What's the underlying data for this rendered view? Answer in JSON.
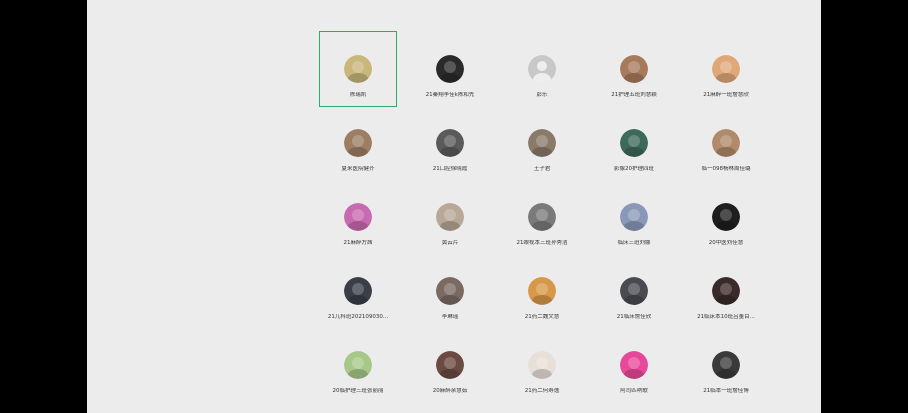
{
  "theme": {
    "background": "#000000",
    "panel": "#ececec",
    "selection_border": "#2aae67",
    "text": "#333333"
  },
  "contacts": [
    {
      "name": "陈瑞凯",
      "avatar_icon": "avatar-photo-icon",
      "color": "#c9b67a",
      "selected": true
    },
    {
      "name": "21秦翔李佳k陈和先",
      "avatar_icon": "avatar-photo-icon",
      "color": "#2a2a2a",
      "selected": false
    },
    {
      "name": "彭乐",
      "avatar_icon": "default-avatar-icon",
      "color": "#c8c8c8",
      "selected": false
    },
    {
      "name": "21护理五班刘慧颖",
      "avatar_icon": "avatar-photo-icon",
      "color": "#a87a5c",
      "selected": false
    },
    {
      "name": "21麻醉一班詹慧欣",
      "avatar_icon": "avatar-photo-icon",
      "color": "#e0a878",
      "selected": false
    },
    {
      "name": "夏米医院健齐",
      "avatar_icon": "avatar-photo-icon",
      "color": "#9c7e62",
      "selected": false
    },
    {
      "name": "21口腔徐晓霞",
      "avatar_icon": "avatar-photo-icon",
      "color": "#5a5a5a",
      "selected": false
    },
    {
      "name": "王子君",
      "avatar_icon": "avatar-photo-icon",
      "color": "#8a7a6a",
      "selected": false
    },
    {
      "name": "影像20护理四班",
      "avatar_icon": "avatar-photo-icon",
      "color": "#3c6a5a",
      "selected": false
    },
    {
      "name": "临一098杨林周佳璐",
      "avatar_icon": "avatar-photo-icon",
      "color": "#b08a6a",
      "selected": false
    },
    {
      "name": "21麻醉方茜",
      "avatar_icon": "avatar-photo-icon",
      "color": "#c86ab0",
      "selected": false
    },
    {
      "name": "黄云芹",
      "avatar_icon": "avatar-photo-icon",
      "color": "#b8a898",
      "selected": false
    },
    {
      "name": "21眼视本三班孙秀洁",
      "avatar_icon": "avatar-photo-icon",
      "color": "#7a7a7a",
      "selected": false
    },
    {
      "name": "临床三班刘娜",
      "avatar_icon": "avatar-photo-icon",
      "color": "#8a98b8",
      "selected": false
    },
    {
      "name": "20中医刘佳慧",
      "avatar_icon": "avatar-photo-icon",
      "color": "#1e1e1e",
      "selected": false
    },
    {
      "name": "21儿科班202109030...",
      "avatar_icon": "avatar-photo-icon",
      "color": "#3a3e48",
      "selected": false
    },
    {
      "name": "李琳瑶",
      "avatar_icon": "avatar-photo-icon",
      "color": "#7a6a62",
      "selected": false
    },
    {
      "name": "21药二魏文慧",
      "avatar_icon": "avatar-photo-icon",
      "color": "#d8984a",
      "selected": false
    },
    {
      "name": "21临床詹佳欣",
      "avatar_icon": "avatar-photo-icon",
      "color": "#4a4a52",
      "selected": false
    },
    {
      "name": "21临床本10班吕董目...",
      "avatar_icon": "avatar-photo-icon",
      "color": "#3a2a2a",
      "selected": false
    },
    {
      "name": "20临护理三班张丽丽",
      "avatar_icon": "avatar-photo-icon",
      "color": "#a8c88a",
      "selected": false
    },
    {
      "name": "20麻醉余慧茹",
      "avatar_icon": "avatar-photo-icon",
      "color": "#6a4a42",
      "selected": false
    },
    {
      "name": "21药二何寿逸",
      "avatar_icon": "avatar-photo-icon",
      "color": "#e8e0d8",
      "selected": false
    },
    {
      "name": "阿司匹咧歌",
      "avatar_icon": "avatar-photo-icon",
      "color": "#e8489a",
      "selected": false
    },
    {
      "name": "21临本一班詹佳博",
      "avatar_icon": "avatar-photo-icon",
      "color": "#3a3a3a",
      "selected": false
    }
  ]
}
